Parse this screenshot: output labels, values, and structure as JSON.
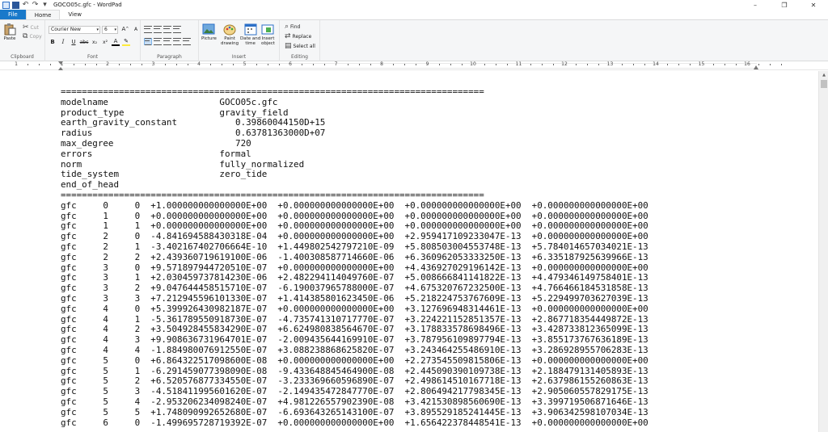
{
  "window": {
    "title": "GOCO05c.gfc - WordPad",
    "minimize": "–",
    "restore": "❐",
    "close": "✕"
  },
  "tabs": [
    "File",
    "Home",
    "View"
  ],
  "ribbon": {
    "clipboard": {
      "label": "Clipboard",
      "paste": "Paste",
      "cut": "Cut",
      "copy": "Copy"
    },
    "font": {
      "label": "Font",
      "family": "Courier New",
      "size": "6",
      "bold": "B",
      "italic": "I",
      "underline": "U",
      "strike": "abc",
      "subscript": "x₂",
      "superscript": "x²",
      "color": "A",
      "highlight": "✎"
    },
    "paragraph": {
      "label": "Paragraph"
    },
    "insert": {
      "label": "Insert",
      "picture": "Picture",
      "paint1": "Paint",
      "paint2": "drawing",
      "date1": "Date and",
      "date2": "time",
      "object1": "Insert",
      "object2": "object"
    },
    "editing": {
      "label": "Editing",
      "find": "Find",
      "replace": "Replace",
      "select_all": "Select all"
    }
  },
  "ruler": {
    "marks": [
      "1",
      "1",
      "2",
      "3",
      "4",
      "5",
      "6",
      "7",
      "8",
      "9",
      "10",
      "11",
      "12",
      "13",
      "14",
      "15",
      "16"
    ]
  },
  "document": {
    "lines": [
      "================================================================================",
      "modelname                     GOCO05c.gfc",
      "product_type                  gravity_field",
      "earth_gravity_constant           0.39860044150D+15",
      "radius                           0.63781363000D+07",
      "max_degree                       720",
      "errors                        formal",
      "norm                          fully_normalized",
      "tide_system                   zero_tide",
      "end_of_head",
      "================================================================================",
      "gfc     0     0  +1.000000000000000E+00  +0.000000000000000E+00  +0.000000000000000E+00  +0.000000000000000E+00",
      "gfc     1     0  +0.000000000000000E+00  +0.000000000000000E+00  +0.000000000000000E+00  +0.000000000000000E+00",
      "gfc     1     1  +0.000000000000000E+00  +0.000000000000000E+00  +0.000000000000000E+00  +0.000000000000000E+00",
      "gfc     2     0  -4.841694588430318E-04  +0.000000000000000E+00  +2.959417109233047E-13  +0.000000000000000E+00",
      "gfc     2     1  -3.402167402706664E-10  +1.449802542797210E-09  +5.808503004553748E-13  +5.784014657034021E-13",
      "gfc     2     2  +2.439360719619100E-06  -1.400308587714660E-06  +6.360962053333250E-13  +6.335187925639966E-13",
      "gfc     3     0  +9.571897944720510E-07  +0.000000000000000E+00  +4.436927029196142E-13  +0.000000000000000E+00",
      "gfc     3     1  +2.030459737814230E-06  +2.482294114049760E-07  +5.008666841141822E-13  +4.479346149758401E-13",
      "gfc     3     2  +9.047644458515710E-07  -6.190037965788000E-07  +4.675320767232500E-13  +4.766466184531858E-13",
      "gfc     3     3  +7.212945596101330E-07  +1.414385801623450E-06  +5.218224753767609E-13  +5.229499703627039E-13",
      "gfc     4     0  +5.399926430982187E-07  +0.000000000000000E+00  +3.127696948314461E-13  +0.000000000000000E+00",
      "gfc     4     1  -5.361789550918730E-07  -4.735741310717770E-07  +3.224221152851357E-13  +2.867718354449872E-13",
      "gfc     4     2  +3.504928455834290E-07  +6.624980838564670E-07  +3.178833578698496E-13  +3.428733812365099E-13",
      "gfc     4     3  +9.908636731964701E-07  -2.009435644169910E-07  +3.787956109897794E-13  +3.855173767636189E-13",
      "gfc     4     4  -1.884980076912550E-07  +3.088238868625820E-07  +3.243464255486910E-13  +3.286928955706283E-13",
      "gfc     5     0  +6.864322517098600E-08  +0.000000000000000E+00  +2.273545509815806E-13  +0.000000000000000E+00",
      "gfc     5     1  -6.291459077398090E-08  -9.433648845464900E-08  +2.445090390109738E-13  +2.188479131405893E-13",
      "gfc     5     2  +6.520576877334550E-07  -3.233369660596890E-07  +2.498614510167718E-13  +2.637986155260863E-13",
      "gfc     5     3  -4.518411995601620E-07  -2.149435472847770E-07  +2.806494217798345E-13  +2.905060557829175E-13",
      "gfc     5     4  -2.953206234098240E-07  +4.981226557902390E-08  +3.421530898560690E-13  +3.399719506871646E-13",
      "gfc     5     5  +1.748090992652680E-07  -6.693643265143100E-07  +3.895529185241445E-13  +3.906342598107034E-13",
      "gfc     6     0  -1.499695728719392E-07  +0.000000000000000E+00  +1.656422378448541E-13  +0.000000000000000E+00"
    ]
  }
}
